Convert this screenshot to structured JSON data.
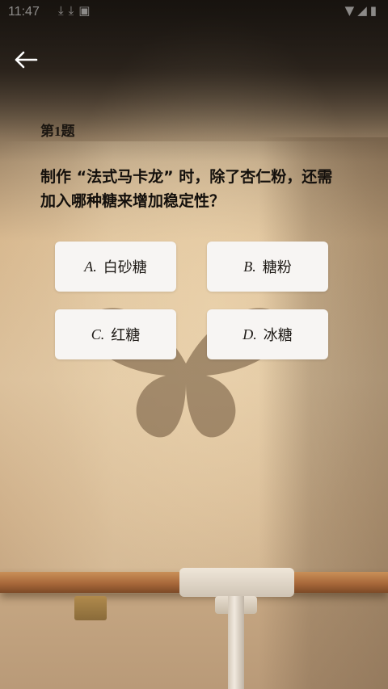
{
  "status_bar": {
    "time": "11:47",
    "notification_icons": [
      "download-icon",
      "download-icon",
      "screenshot-icon"
    ],
    "system_icons": [
      "wifi-icon",
      "signal-icon",
      "battery-icon"
    ]
  },
  "header": {
    "back_icon": "arrow-left-icon"
  },
  "quiz": {
    "question_number": "第1题",
    "question_text": "制作 “法式马卡龙” 时，除了杏仁粉，还需加入哪种糖来增加稳定性？",
    "options": [
      {
        "letter": "A.",
        "label": "白砂糖"
      },
      {
        "letter": "B.",
        "label": "糖粉"
      },
      {
        "letter": "C.",
        "label": "红糖"
      },
      {
        "letter": "D.",
        "label": "冰糖"
      }
    ]
  },
  "colors": {
    "option_bg": "#f7f5f3",
    "text_dark": "#14100c",
    "wall_warm": "#dcc19c"
  }
}
